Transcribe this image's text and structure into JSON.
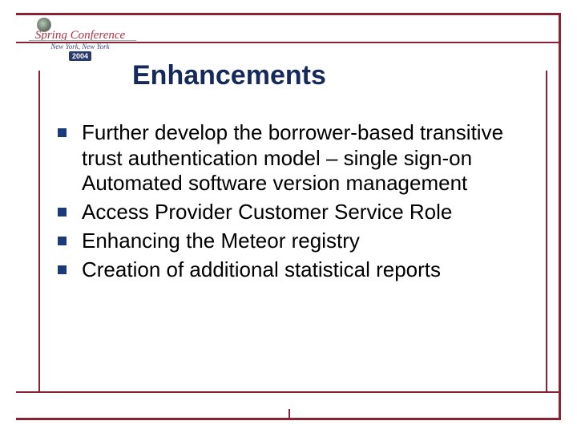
{
  "logo": {
    "line1": "Spring Conference",
    "line2": "New York, New York",
    "year": "2004"
  },
  "title": "Enhancements",
  "bullets": [
    "Further develop the borrower-based transitive trust authentication model – single sign-on Automated software version management",
    "Access Provider Customer Service Role",
    "Enhancing the Meteor registry",
    "Creation of additional statistical reports"
  ]
}
